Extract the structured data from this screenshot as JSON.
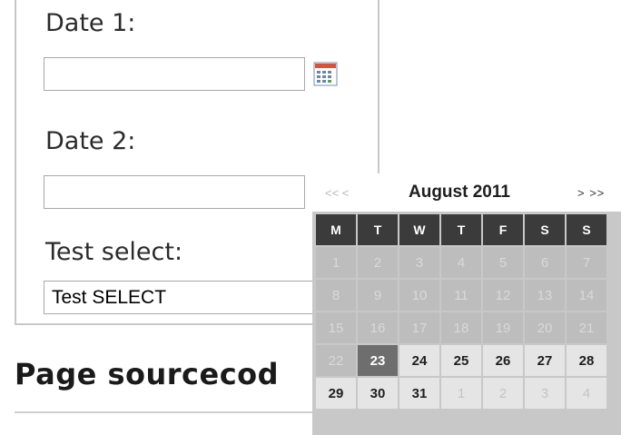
{
  "form": {
    "date1_label": "Date 1:",
    "date1_value": "",
    "date2_label": "Date 2:",
    "date2_value": "",
    "select_label": "Test select:",
    "select_value": "Test SELECT"
  },
  "page": {
    "heading": "Page sourcecod"
  },
  "calendar": {
    "prev_label": "<< <",
    "next_label": "> >>",
    "title": "August 2011",
    "weekdays": [
      "M",
      "T",
      "W",
      "T",
      "F",
      "S",
      "S"
    ],
    "weeks": [
      [
        "1",
        "2",
        "3",
        "4",
        "5",
        "6",
        "7"
      ],
      [
        "8",
        "9",
        "10",
        "11",
        "12",
        "13",
        "14"
      ],
      [
        "15",
        "16",
        "17",
        "18",
        "19",
        "20",
        "21"
      ],
      [
        "22",
        "23",
        "24",
        "25",
        "26",
        "27",
        "28"
      ],
      [
        "29",
        "30",
        "31",
        "1",
        "2",
        "3",
        "4"
      ]
    ],
    "today": "23"
  },
  "icons": {
    "date1_picker": "calendar-icon"
  },
  "colors": {
    "header_cell": "#3b3b3b",
    "selected_day": "#6e6e6e"
  }
}
